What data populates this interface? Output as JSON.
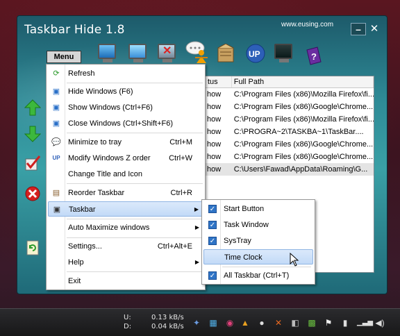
{
  "window": {
    "title": "Taskbar Hide 1.8",
    "site": "www.eusing.com",
    "minimize": "–",
    "close": "✕"
  },
  "menu_button": "Menu",
  "toolbar_icons": [
    "monitor-icon",
    "monitor-show-icon",
    "monitor-close-icon",
    "chat-icon",
    "user-icon",
    "box-icon",
    "update-icon",
    "screen-icon",
    "help-icon"
  ],
  "side_icons": [
    "arrow-up-icon",
    "arrow-down-icon",
    "check-icon",
    "delete-icon",
    "refresh-icon"
  ],
  "listview": {
    "headers": [
      "tus",
      "Full Path"
    ],
    "rows": [
      {
        "status": "how",
        "path": "C:\\Program Files (x86)\\Mozilla Firefox\\fi..."
      },
      {
        "status": "how",
        "path": "C:\\Program Files (x86)\\Google\\Chrome..."
      },
      {
        "status": "how",
        "path": "C:\\Program Files (x86)\\Mozilla Firefox\\fi..."
      },
      {
        "status": "how",
        "path": "C:\\PROGRA~2\\TASKBA~1\\TaskBar...."
      },
      {
        "status": "how",
        "path": "C:\\Program Files (x86)\\Google\\Chrome..."
      },
      {
        "status": "how",
        "path": "C:\\Program Files (x86)\\Google\\Chrome..."
      },
      {
        "status": "how",
        "path": "C:\\Users\\Fawad\\AppData\\Roaming\\G..."
      }
    ]
  },
  "menu": {
    "items": [
      {
        "label": "Refresh",
        "shortcut": ""
      },
      {
        "label": "Hide Windows   (F6)",
        "shortcut": ""
      },
      {
        "label": "Show Windows  (Ctrl+F6)",
        "shortcut": ""
      },
      {
        "label": "Close Windows  (Ctrl+Shift+F6)",
        "shortcut": ""
      },
      {
        "label": "Minimize to tray",
        "shortcut": "Ctrl+M"
      },
      {
        "label": "Modify Windows Z order",
        "shortcut": "Ctrl+W"
      },
      {
        "label": "Change Title and Icon",
        "shortcut": ""
      },
      {
        "label": "Reorder Taskbar",
        "shortcut": "Ctrl+R"
      },
      {
        "label": "Taskbar",
        "shortcut": ""
      },
      {
        "label": "Auto Maximize windows",
        "shortcut": ""
      },
      {
        "label": "Settings...",
        "shortcut": "Ctrl+Alt+E"
      },
      {
        "label": "Help",
        "shortcut": ""
      },
      {
        "label": "Exit",
        "shortcut": ""
      }
    ],
    "arrow": "▶"
  },
  "submenu": {
    "items": [
      {
        "label": "Start Button",
        "checked": true
      },
      {
        "label": "Task Window",
        "checked": true
      },
      {
        "label": "SysTray",
        "checked": true
      },
      {
        "label": "Time Clock",
        "checked": false
      },
      {
        "label": "All Taskbar  (Ctrl+T)",
        "checked": true
      }
    ],
    "check_glyph": "✓"
  },
  "taskbar": {
    "up_label": "U:",
    "down_label": "D:",
    "up_speed": "0.13 kB/s",
    "down_speed": "0.04 kB/s"
  }
}
